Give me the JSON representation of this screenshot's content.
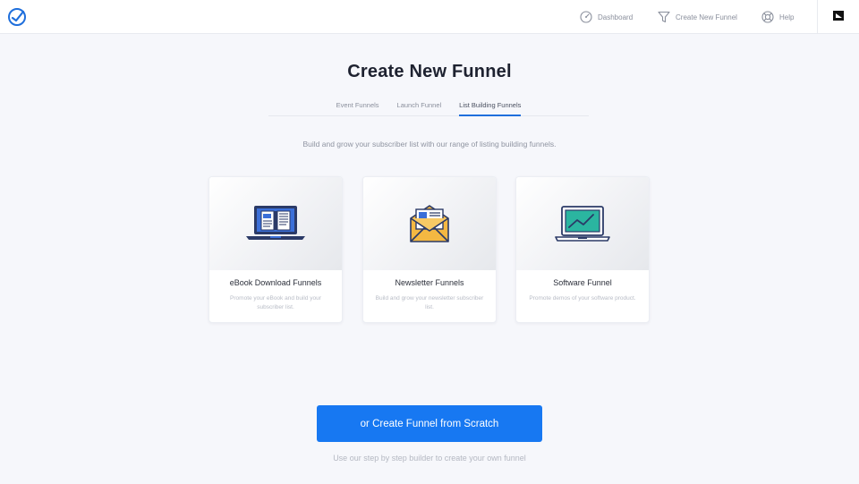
{
  "topbar": {
    "nav": [
      {
        "label": "Dashboard",
        "icon": "dashboard-gauge-icon"
      },
      {
        "label": "Create New Funnel",
        "icon": "funnel-icon"
      },
      {
        "label": "Help",
        "icon": "lifebuoy-icon"
      }
    ]
  },
  "page": {
    "title": "Create New Funnel",
    "subtitle": "Build and grow your subscriber list with our range of listing building funnels."
  },
  "tabs": [
    {
      "label": "Event Funnels",
      "active": false
    },
    {
      "label": "Launch Funnel",
      "active": false
    },
    {
      "label": "List Building Funnels",
      "active": true
    }
  ],
  "cards": [
    {
      "title": "eBook Download Funnels",
      "description": "Promote your eBook and build your subscriber list.",
      "icon": "ebook-laptop-icon"
    },
    {
      "title": "Newsletter Funnels",
      "description": "Build and grow your newsletter subscriber list.",
      "icon": "newsletter-envelope-icon"
    },
    {
      "title": "Software Funnel",
      "description": "Promote demos of your software product.",
      "icon": "software-laptop-chart-icon"
    }
  ],
  "scratch": {
    "button_label": "or Create Funnel from Scratch",
    "note": "Use our step by step builder to create your own funnel"
  },
  "colors": {
    "accent": "#1778f2",
    "background": "#f6f7fb",
    "icon_navy": "#2b3a67",
    "icon_blue": "#3b6fd8",
    "icon_yellow": "#f4b842",
    "icon_teal": "#2bb5a0"
  }
}
